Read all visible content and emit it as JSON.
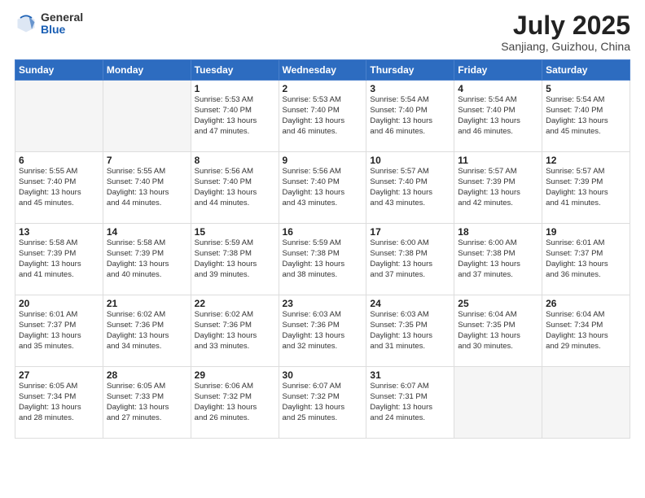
{
  "logo": {
    "general": "General",
    "blue": "Blue"
  },
  "header": {
    "month": "July 2025",
    "location": "Sanjiang, Guizhou, China"
  },
  "weekdays": [
    "Sunday",
    "Monday",
    "Tuesday",
    "Wednesday",
    "Thursday",
    "Friday",
    "Saturday"
  ],
  "weeks": [
    [
      {
        "day": "",
        "info": ""
      },
      {
        "day": "",
        "info": ""
      },
      {
        "day": "1",
        "info": "Sunrise: 5:53 AM\nSunset: 7:40 PM\nDaylight: 13 hours\nand 47 minutes."
      },
      {
        "day": "2",
        "info": "Sunrise: 5:53 AM\nSunset: 7:40 PM\nDaylight: 13 hours\nand 46 minutes."
      },
      {
        "day": "3",
        "info": "Sunrise: 5:54 AM\nSunset: 7:40 PM\nDaylight: 13 hours\nand 46 minutes."
      },
      {
        "day": "4",
        "info": "Sunrise: 5:54 AM\nSunset: 7:40 PM\nDaylight: 13 hours\nand 46 minutes."
      },
      {
        "day": "5",
        "info": "Sunrise: 5:54 AM\nSunset: 7:40 PM\nDaylight: 13 hours\nand 45 minutes."
      }
    ],
    [
      {
        "day": "6",
        "info": "Sunrise: 5:55 AM\nSunset: 7:40 PM\nDaylight: 13 hours\nand 45 minutes."
      },
      {
        "day": "7",
        "info": "Sunrise: 5:55 AM\nSunset: 7:40 PM\nDaylight: 13 hours\nand 44 minutes."
      },
      {
        "day": "8",
        "info": "Sunrise: 5:56 AM\nSunset: 7:40 PM\nDaylight: 13 hours\nand 44 minutes."
      },
      {
        "day": "9",
        "info": "Sunrise: 5:56 AM\nSunset: 7:40 PM\nDaylight: 13 hours\nand 43 minutes."
      },
      {
        "day": "10",
        "info": "Sunrise: 5:57 AM\nSunset: 7:40 PM\nDaylight: 13 hours\nand 43 minutes."
      },
      {
        "day": "11",
        "info": "Sunrise: 5:57 AM\nSunset: 7:39 PM\nDaylight: 13 hours\nand 42 minutes."
      },
      {
        "day": "12",
        "info": "Sunrise: 5:57 AM\nSunset: 7:39 PM\nDaylight: 13 hours\nand 41 minutes."
      }
    ],
    [
      {
        "day": "13",
        "info": "Sunrise: 5:58 AM\nSunset: 7:39 PM\nDaylight: 13 hours\nand 41 minutes."
      },
      {
        "day": "14",
        "info": "Sunrise: 5:58 AM\nSunset: 7:39 PM\nDaylight: 13 hours\nand 40 minutes."
      },
      {
        "day": "15",
        "info": "Sunrise: 5:59 AM\nSunset: 7:38 PM\nDaylight: 13 hours\nand 39 minutes."
      },
      {
        "day": "16",
        "info": "Sunrise: 5:59 AM\nSunset: 7:38 PM\nDaylight: 13 hours\nand 38 minutes."
      },
      {
        "day": "17",
        "info": "Sunrise: 6:00 AM\nSunset: 7:38 PM\nDaylight: 13 hours\nand 37 minutes."
      },
      {
        "day": "18",
        "info": "Sunrise: 6:00 AM\nSunset: 7:38 PM\nDaylight: 13 hours\nand 37 minutes."
      },
      {
        "day": "19",
        "info": "Sunrise: 6:01 AM\nSunset: 7:37 PM\nDaylight: 13 hours\nand 36 minutes."
      }
    ],
    [
      {
        "day": "20",
        "info": "Sunrise: 6:01 AM\nSunset: 7:37 PM\nDaylight: 13 hours\nand 35 minutes."
      },
      {
        "day": "21",
        "info": "Sunrise: 6:02 AM\nSunset: 7:36 PM\nDaylight: 13 hours\nand 34 minutes."
      },
      {
        "day": "22",
        "info": "Sunrise: 6:02 AM\nSunset: 7:36 PM\nDaylight: 13 hours\nand 33 minutes."
      },
      {
        "day": "23",
        "info": "Sunrise: 6:03 AM\nSunset: 7:36 PM\nDaylight: 13 hours\nand 32 minutes."
      },
      {
        "day": "24",
        "info": "Sunrise: 6:03 AM\nSunset: 7:35 PM\nDaylight: 13 hours\nand 31 minutes."
      },
      {
        "day": "25",
        "info": "Sunrise: 6:04 AM\nSunset: 7:35 PM\nDaylight: 13 hours\nand 30 minutes."
      },
      {
        "day": "26",
        "info": "Sunrise: 6:04 AM\nSunset: 7:34 PM\nDaylight: 13 hours\nand 29 minutes."
      }
    ],
    [
      {
        "day": "27",
        "info": "Sunrise: 6:05 AM\nSunset: 7:34 PM\nDaylight: 13 hours\nand 28 minutes."
      },
      {
        "day": "28",
        "info": "Sunrise: 6:05 AM\nSunset: 7:33 PM\nDaylight: 13 hours\nand 27 minutes."
      },
      {
        "day": "29",
        "info": "Sunrise: 6:06 AM\nSunset: 7:32 PM\nDaylight: 13 hours\nand 26 minutes."
      },
      {
        "day": "30",
        "info": "Sunrise: 6:07 AM\nSunset: 7:32 PM\nDaylight: 13 hours\nand 25 minutes."
      },
      {
        "day": "31",
        "info": "Sunrise: 6:07 AM\nSunset: 7:31 PM\nDaylight: 13 hours\nand 24 minutes."
      },
      {
        "day": "",
        "info": ""
      },
      {
        "day": "",
        "info": ""
      }
    ]
  ]
}
